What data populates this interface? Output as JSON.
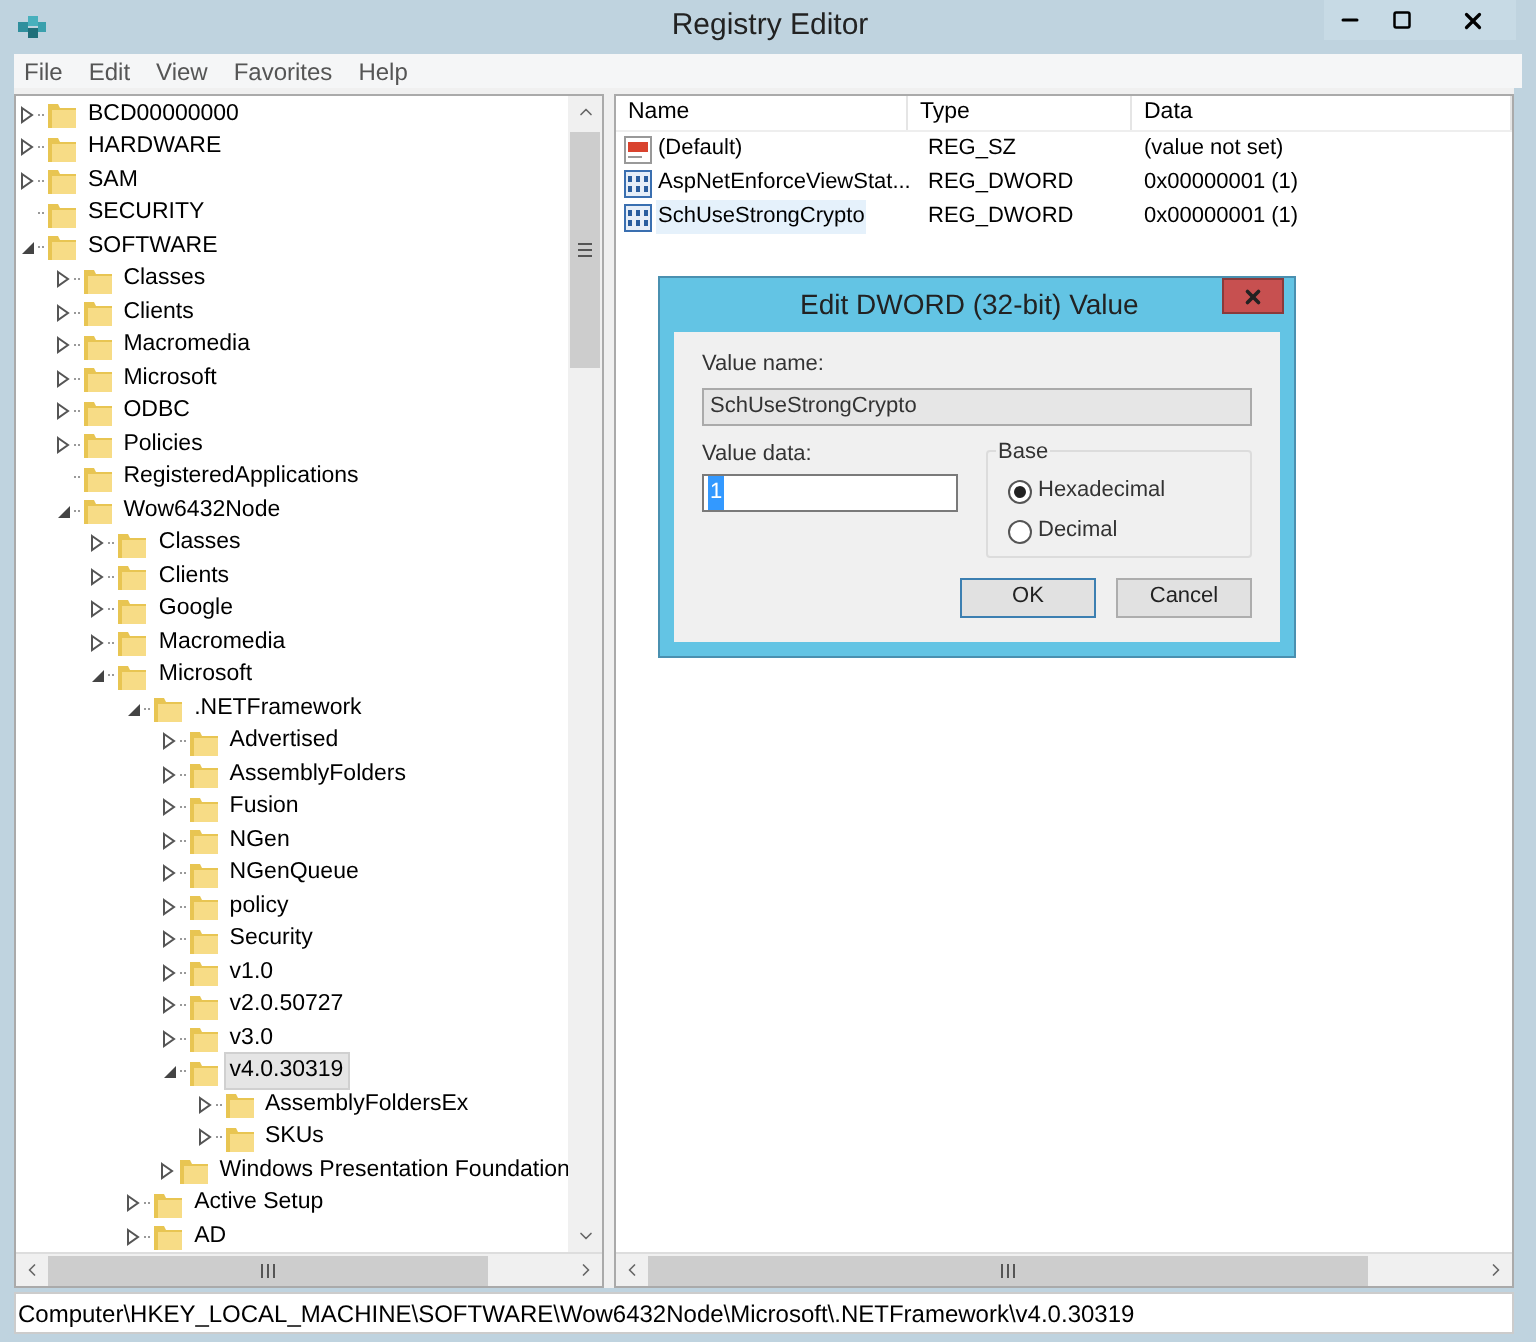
{
  "window": {
    "title": "Registry Editor"
  },
  "menu": [
    "File",
    "Edit",
    "View",
    "Favorites",
    "Help"
  ],
  "tree": [
    {
      "label": "BCD00000000",
      "kind": "node",
      "expanded": false,
      "selected": false
    },
    {
      "label": "HARDWARE",
      "kind": "node",
      "expanded": false,
      "selected": false
    },
    {
      "label": "SAM",
      "kind": "node",
      "expanded": false,
      "selected": false
    },
    {
      "label": "SECURITY",
      "kind": "leaf",
      "selected": false
    },
    {
      "label": "SOFTWARE",
      "kind": "node",
      "expanded": true,
      "selected": false,
      "children": [
        {
          "label": "Classes",
          "kind": "node",
          "expanded": false,
          "selected": false
        },
        {
          "label": "Clients",
          "kind": "node",
          "expanded": false,
          "selected": false
        },
        {
          "label": "Macromedia",
          "kind": "node",
          "expanded": false,
          "selected": false
        },
        {
          "label": "Microsoft",
          "kind": "node",
          "expanded": false,
          "selected": false
        },
        {
          "label": "ODBC",
          "kind": "node",
          "expanded": false,
          "selected": false
        },
        {
          "label": "Policies",
          "kind": "node",
          "expanded": false,
          "selected": false
        },
        {
          "label": "RegisteredApplications",
          "kind": "leaf",
          "selected": false
        },
        {
          "label": "Wow6432Node",
          "kind": "node",
          "expanded": true,
          "selected": false,
          "children": [
            {
              "label": "Classes",
              "kind": "node",
              "expanded": false,
              "selected": false
            },
            {
              "label": "Clients",
              "kind": "node",
              "expanded": false,
              "selected": false
            },
            {
              "label": "Google",
              "kind": "node",
              "expanded": false,
              "selected": false
            },
            {
              "label": "Macromedia",
              "kind": "node",
              "expanded": false,
              "selected": false
            },
            {
              "label": "Microsoft",
              "kind": "node",
              "expanded": true,
              "selected": false,
              "children": [
                {
                  "label": ".NETFramework",
                  "kind": "node",
                  "expanded": true,
                  "selected": false,
                  "children": [
                    {
                      "label": "Advertised",
                      "kind": "node",
                      "expanded": false,
                      "selected": false
                    },
                    {
                      "label": "AssemblyFolders",
                      "kind": "node",
                      "expanded": false,
                      "selected": false
                    },
                    {
                      "label": "Fusion",
                      "kind": "node",
                      "expanded": false,
                      "selected": false
                    },
                    {
                      "label": "NGen",
                      "kind": "node",
                      "expanded": false,
                      "selected": false
                    },
                    {
                      "label": "NGenQueue",
                      "kind": "node",
                      "expanded": false,
                      "selected": false
                    },
                    {
                      "label": "policy",
                      "kind": "node",
                      "expanded": false,
                      "selected": false
                    },
                    {
                      "label": "Security",
                      "kind": "node",
                      "expanded": false,
                      "selected": false
                    },
                    {
                      "label": "v1.0",
                      "kind": "node",
                      "expanded": false,
                      "selected": false
                    },
                    {
                      "label": "v2.0.50727",
                      "kind": "node",
                      "expanded": false,
                      "selected": false
                    },
                    {
                      "label": "v3.0",
                      "kind": "node",
                      "expanded": false,
                      "selected": false
                    },
                    {
                      "label": "v4.0.30319",
                      "kind": "node",
                      "expanded": true,
                      "selected": true,
                      "children": [
                        {
                          "label": "AssemblyFoldersEx",
                          "kind": "node",
                          "expanded": false,
                          "selected": false
                        },
                        {
                          "label": "SKUs",
                          "kind": "node",
                          "expanded": false,
                          "selected": false
                        }
                      ]
                    },
                    {
                      "label": "Windows Presentation Foundation",
                      "kind": "node",
                      "expanded": false,
                      "selected": false
                    }
                  ]
                },
                {
                  "label": "Active Setup",
                  "kind": "node",
                  "expanded": false,
                  "selected": false
                },
                {
                  "label": "AD",
                  "kind": "node",
                  "expanded": false,
                  "selected": false
                }
              ]
            }
          ]
        }
      ]
    }
  ],
  "values": {
    "columns": [
      "Name",
      "Type",
      "Data"
    ],
    "rows": [
      {
        "kind": "string",
        "name": "(Default)",
        "type": "REG_SZ",
        "data": "(value not set)",
        "selected": false
      },
      {
        "kind": "binary",
        "name": "AspNetEnforceViewStat...",
        "type": "REG_DWORD",
        "data": "0x00000001 (1)",
        "selected": false
      },
      {
        "kind": "binary",
        "name": "SchUseStrongCrypto",
        "type": "REG_DWORD",
        "data": "0x00000001 (1)",
        "selected": true
      }
    ]
  },
  "dialog": {
    "title": "Edit DWORD (32-bit) Value",
    "value_name_label": "Value name:",
    "value_name": "SchUseStrongCrypto",
    "value_data_label": "Value data:",
    "value_data": "1",
    "base_label": "Base",
    "bases": [
      {
        "label": "Hexadecimal",
        "selected": true
      },
      {
        "label": "Decimal",
        "selected": false
      }
    ],
    "buttons": [
      "OK",
      "Cancel"
    ]
  },
  "status_bar": "Computer\\HKEY_LOCAL_MACHINE\\SOFTWARE\\Wow6432Node\\Microsoft\\.NETFramework\\v4.0.30319"
}
